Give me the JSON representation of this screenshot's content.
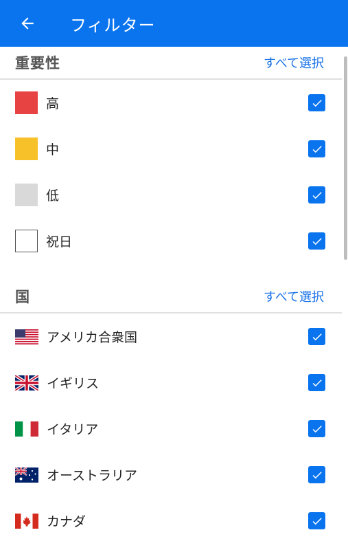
{
  "appbar": {
    "title": "フィルター",
    "back_icon": "arrow-left-icon"
  },
  "colors": {
    "accent": "#0a74ef",
    "high": "#e84343",
    "medium": "#f7c12a",
    "low": "#d9d9d9",
    "holiday": "#ffffff"
  },
  "importance": {
    "title": "重要性",
    "select_all": "すべて選択",
    "items": [
      {
        "label": "高",
        "checked": true
      },
      {
        "label": "中",
        "checked": true
      },
      {
        "label": "低",
        "checked": true
      },
      {
        "label": "祝日",
        "checked": true
      }
    ]
  },
  "countries": {
    "title": "国",
    "select_all": "すべて選択",
    "items": [
      {
        "label": "アメリカ合衆国",
        "flag": "us-flag-icon",
        "checked": true
      },
      {
        "label": "イギリス",
        "flag": "uk-flag-icon",
        "checked": true
      },
      {
        "label": "イタリア",
        "flag": "italy-flag-icon",
        "checked": true
      },
      {
        "label": "オーストラリア",
        "flag": "australia-flag-icon",
        "checked": true
      },
      {
        "label": "カナダ",
        "flag": "canada-flag-icon",
        "checked": true
      }
    ]
  }
}
